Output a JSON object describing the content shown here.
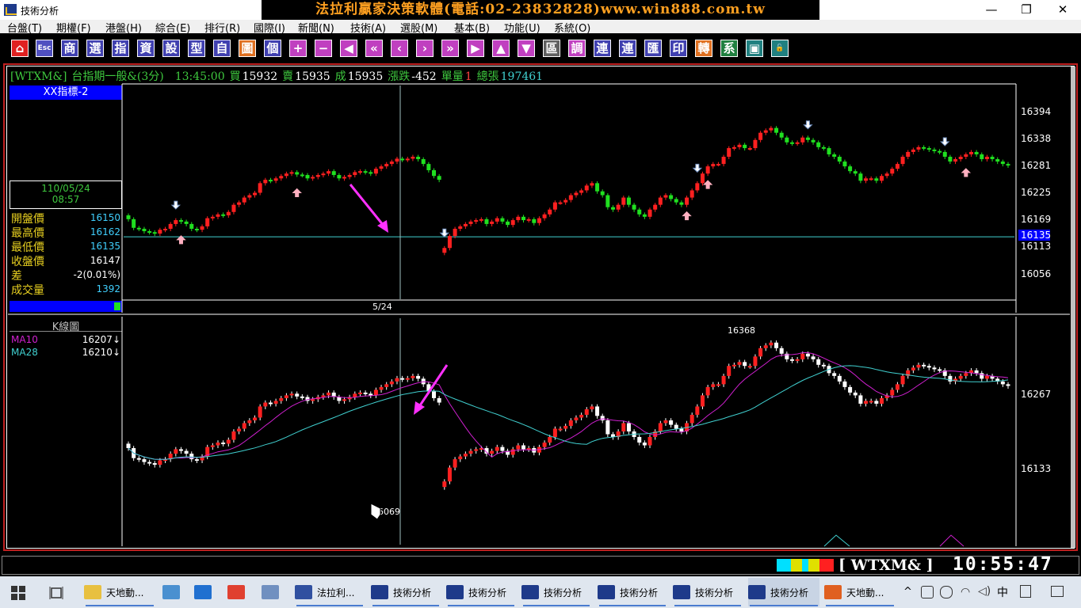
{
  "window": {
    "app_title": "技術分析",
    "banner": "法拉利贏家決策軟體(電話:02-23832828)www.win888.com.tw",
    "min": "—",
    "restore": "❐",
    "close": "✕"
  },
  "menu": [
    "台盤(T)",
    "期權(F)",
    "港盤(H)",
    "綜合(E)",
    "排行(R)",
    "國際(I)",
    "新聞(N)",
    "技術(A)",
    "選股(M)",
    "基本(B)",
    "功能(U)",
    "系統(O)"
  ],
  "toolbar": [
    {
      "label": "⌂",
      "icon": "home-icon",
      "bg": "#e02020"
    },
    {
      "label": "Esc",
      "icon": "esc-icon",
      "bg": "#5050c0"
    },
    {
      "label": "商",
      "icon": "shang-icon",
      "bg": "#4040b0"
    },
    {
      "label": "選",
      "icon": "select-icon",
      "bg": "#4040b0"
    },
    {
      "label": "指",
      "icon": "index-icon",
      "bg": "#4040b0"
    },
    {
      "label": "資",
      "icon": "data-icon",
      "bg": "#4040b0"
    },
    {
      "label": "設",
      "icon": "settings-icon",
      "bg": "#4040b0"
    },
    {
      "label": "型",
      "icon": "pattern-icon",
      "bg": "#4040b0"
    },
    {
      "label": "自",
      "icon": "self-icon",
      "bg": "#4040b0"
    },
    {
      "label": "圖",
      "icon": "chart-icon",
      "bg": "#e07020"
    },
    {
      "label": "個",
      "icon": "single-icon",
      "bg": "#4040b0"
    },
    {
      "label": "+",
      "icon": "zoom-in-icon",
      "bg": "#c040c0"
    },
    {
      "label": "−",
      "icon": "zoom-out-icon",
      "bg": "#c040c0"
    },
    {
      "label": "◀",
      "icon": "left-icon",
      "bg": "#c040c0"
    },
    {
      "label": "«",
      "icon": "fast-left-icon",
      "bg": "#c040c0"
    },
    {
      "label": "‹",
      "icon": "prev-icon",
      "bg": "#c040c0"
    },
    {
      "label": "›",
      "icon": "next-icon",
      "bg": "#c040c0"
    },
    {
      "label": "»",
      "icon": "fast-right-icon",
      "bg": "#c040c0"
    },
    {
      "label": "▶",
      "icon": "right-icon",
      "bg": "#c040c0"
    },
    {
      "label": "▲",
      "icon": "up-icon",
      "bg": "#c040c0"
    },
    {
      "label": "▼",
      "icon": "down-icon",
      "bg": "#c040c0"
    },
    {
      "label": "區",
      "icon": "area-icon",
      "bg": "#606060"
    },
    {
      "label": "調",
      "icon": "adjust-icon",
      "bg": "#c040c0"
    },
    {
      "label": "連",
      "icon": "link-icon",
      "bg": "#4040b0"
    },
    {
      "label": "連",
      "icon": "link2-icon",
      "bg": "#4040b0"
    },
    {
      "label": "匯",
      "icon": "export-icon",
      "bg": "#4040b0"
    },
    {
      "label": "印",
      "icon": "print-icon",
      "bg": "#4040b0"
    },
    {
      "label": "轉",
      "icon": "convert-icon",
      "bg": "#e07020"
    },
    {
      "label": "系",
      "icon": "system-icon",
      "bg": "#208040"
    },
    {
      "label": "▣",
      "icon": "window-icon",
      "bg": "#208080"
    },
    {
      "label": "🔓",
      "icon": "unlock-icon",
      "bg": "#208080"
    }
  ],
  "quote": {
    "code": "[WTXM&]",
    "name": "台指期一般&(3分)",
    "time": "13:45:00",
    "bid_label": "買",
    "bid": "15932",
    "ask_label": "賣",
    "ask": "15935",
    "deal_label": "成",
    "deal": "15935",
    "chg_label": "漲跌",
    "chg": "-452",
    "qty_label": "單量",
    "qty": "1",
    "total_label": "總張",
    "total": "197461"
  },
  "indicator_title": "XX指標-2",
  "date_box": {
    "date": "110/05/24",
    "time": "08:57"
  },
  "info": [
    {
      "label": "開盤價",
      "value": "16150",
      "color": "#40d0ff"
    },
    {
      "label": "最高價",
      "value": "16162",
      "color": "#40d0ff"
    },
    {
      "label": "最低價",
      "value": "16135",
      "color": "#40d0ff"
    },
    {
      "label": "收盤價",
      "value": "16147",
      "color": "#ffffff"
    },
    {
      "label": "差",
      "value": "-2(0.01%)",
      "color": "#ffffff"
    },
    {
      "label": "成交量",
      "value": "1392",
      "color": "#40d0ff"
    }
  ],
  "cursor_date": "5/24",
  "kline_title": "K線圖",
  "ma": [
    {
      "name": "MA10",
      "value": "16207↓",
      "color": "#d020d0"
    },
    {
      "name": "MA28",
      "value": "16210↓",
      "color": "#40d0d0"
    }
  ],
  "status": {
    "code": "[ WTXM&   ]",
    "clock": "10:55:47"
  },
  "taskbar": [
    {
      "label": "天地動...",
      "icon": "folder-icon",
      "color": "#e8c040"
    },
    {
      "label": "",
      "icon": "pc-icon",
      "color": "#4a90d0"
    },
    {
      "label": "",
      "icon": "ie-icon",
      "color": "#2070d0"
    },
    {
      "label": "",
      "icon": "chrome-icon",
      "color": "#e04030"
    },
    {
      "label": "",
      "icon": "paint-icon",
      "color": "#7090c0"
    },
    {
      "label": "法拉利...",
      "icon": "ferrari-icon",
      "color": "#3050a0"
    },
    {
      "label": "技術分析",
      "icon": "ta-icon",
      "color": "#1e3a8a"
    },
    {
      "label": "技術分析",
      "icon": "ta-icon",
      "color": "#1e3a8a"
    },
    {
      "label": "技術分析",
      "icon": "ta-icon",
      "color": "#1e3a8a"
    },
    {
      "label": "技術分析",
      "icon": "ta-icon",
      "color": "#1e3a8a"
    },
    {
      "label": "技術分析",
      "icon": "ta-icon",
      "color": "#1e3a8a"
    },
    {
      "label": "技術分析",
      "icon": "ta-icon",
      "color": "#1e3a8a"
    },
    {
      "label": "天地動...",
      "icon": "office-icon",
      "color": "#e06020"
    }
  ],
  "tray": {
    "ime": "中"
  },
  "chart_data": [
    {
      "type": "candlestick",
      "title": "XX指標-2",
      "y_ticks": [
        "16394",
        "16338",
        "16281",
        "16225",
        "16169",
        "16135",
        "16113",
        "16056"
      ],
      "current_price": "16135",
      "date_label": "5/24",
      "closes": [
        16170,
        16152,
        16150,
        16145,
        16143,
        16140,
        16148,
        16150,
        16160,
        16168,
        16165,
        16160,
        16150,
        16148,
        16155,
        16172,
        16175,
        16180,
        16178,
        16185,
        16200,
        16205,
        16215,
        16220,
        16225,
        16245,
        16252,
        16250,
        16255,
        16260,
        16265,
        16268,
        16263,
        16262,
        16255,
        16258,
        16262,
        16265,
        16270,
        16262,
        16255,
        16258,
        16262,
        16268,
        16270,
        16268,
        16265,
        16275,
        16280,
        16285,
        16290,
        16296,
        16294,
        16296,
        16300,
        16295,
        16285,
        16272,
        16260,
        16252,
        16110,
        16135,
        16150,
        16155,
        16160,
        16165,
        16168,
        16170,
        16160,
        16165,
        16172,
        16165,
        16158,
        16168,
        16175,
        16168,
        16170,
        16162,
        16172,
        16180,
        16190,
        16205,
        16205,
        16210,
        16220,
        16225,
        16230,
        16240,
        16245,
        16228,
        16220,
        16195,
        16190,
        16200,
        16215,
        16200,
        16190,
        16180,
        16175,
        16190,
        16200,
        16215,
        16220,
        16212,
        16205,
        16200,
        16215,
        16230,
        16245,
        16265,
        16280,
        16285,
        16285,
        16300,
        16318,
        16320,
        16325,
        16318,
        16318,
        16335,
        16350,
        16355,
        16360,
        16350,
        16340,
        16330,
        16328,
        16330,
        16340,
        16335,
        16330,
        16320,
        16318,
        16305,
        16300,
        16290,
        16280,
        16270,
        16265,
        16250,
        16255,
        16255,
        16250,
        16260,
        16265,
        16275,
        16285,
        16300,
        16310,
        16315,
        16320,
        16318,
        16315,
        16312,
        16310,
        16300,
        16290,
        16295,
        16300,
        16305,
        16310,
        16305,
        16295,
        16300,
        16295,
        16290,
        16285,
        16282
      ],
      "labels": {
        "buy_arrows": [
          10,
          32,
          106,
          110,
          159
        ],
        "sell_arrows": [
          9,
          60,
          108,
          129,
          155
        ]
      }
    },
    {
      "type": "candlestick",
      "title": "K線圖",
      "series": [
        {
          "name": "MA10",
          "value": "16207↓"
        },
        {
          "name": "MA28",
          "value": "16210↓"
        }
      ],
      "y_ticks": [
        "16267",
        "16133"
      ],
      "high_label": "16368",
      "low_label": "16069"
    }
  ]
}
